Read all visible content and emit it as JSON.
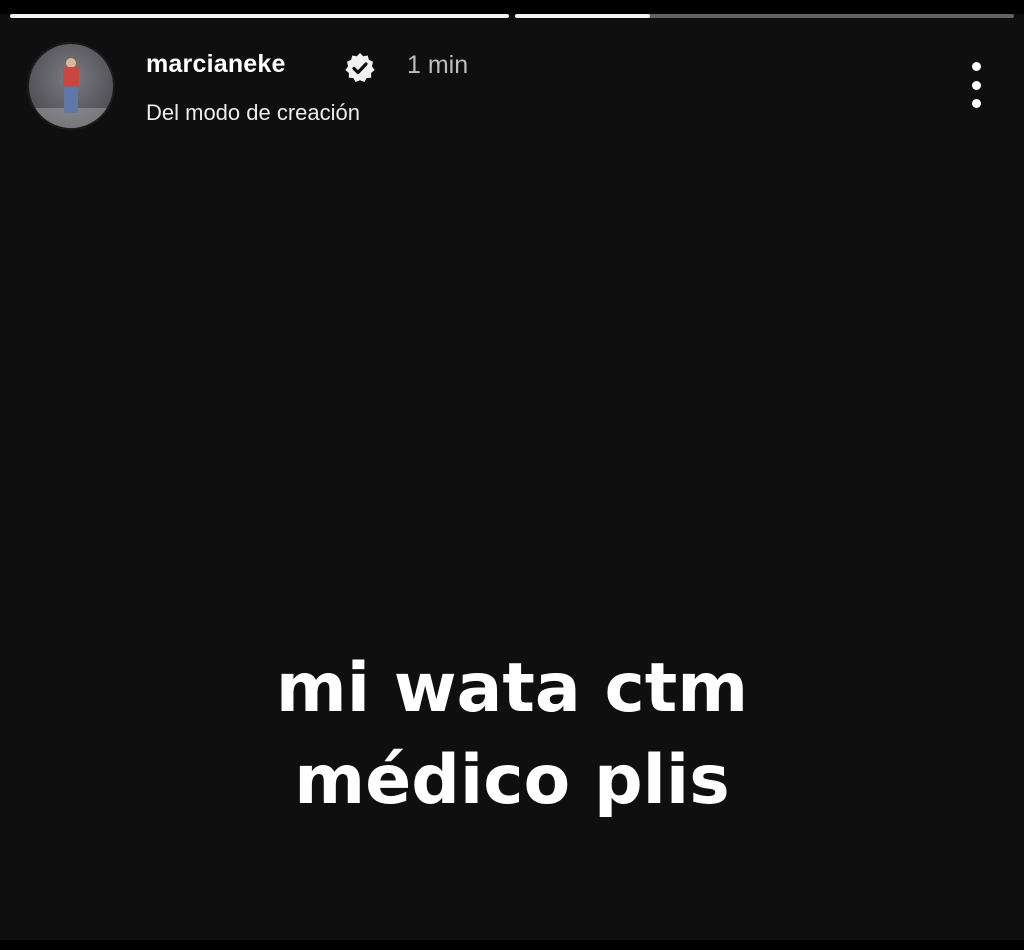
{
  "story": {
    "progress": [
      1.0,
      0.27
    ],
    "user": {
      "username": "marcianeke",
      "verified": true,
      "time_ago": "1 min",
      "subtitle": "Del modo de creación"
    },
    "caption": {
      "line1": "mi wata ctm",
      "line2": "médico plis"
    },
    "icons": {
      "verified": "verified-badge-icon",
      "more": "more-vertical-icon"
    },
    "colors": {
      "background": "#0f0f0f",
      "text": "#ffffff",
      "muted": "#bdbdbd"
    }
  }
}
